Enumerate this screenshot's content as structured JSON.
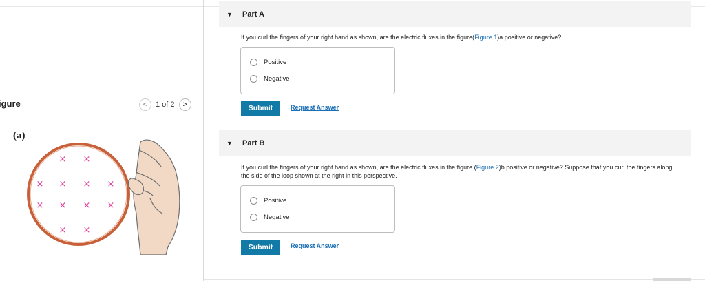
{
  "figure_panel": {
    "title": "igure",
    "page_indicator": "1 of 2",
    "prev_symbol": "<",
    "next_symbol": ">",
    "figure_label": "(a)",
    "field_mark": "×",
    "field_color": "#e0409a",
    "loop_color": "#c8603a"
  },
  "part_a": {
    "toggle_symbol": "▼",
    "title": "Part A",
    "question_before": "If you curl the fingers of your right hand as shown, are the electric fluxes in the figure(",
    "question_link": "Figure 1",
    "question_after": ")a positive or negative?",
    "options": [
      "Positive",
      "Negative"
    ],
    "submit_label": "Submit",
    "request_label": "Request Answer"
  },
  "part_b": {
    "toggle_symbol": "▼",
    "title": "Part B",
    "question_before": "If you curl the fingers of your right hand as shown, are the electric fluxes in the figure (",
    "question_link": "Figure 2",
    "question_after": ")b positive or negative? Suppose that you curl the fingers along the side of the loop shown at the right in this perspective.",
    "options": [
      "Positive",
      "Negative"
    ],
    "submit_label": "Submit",
    "request_label": "Request Answer"
  },
  "colors": {
    "accent": "#117aa7",
    "link": "#1a6fb5",
    "header_bg": "#f3f3f3"
  }
}
